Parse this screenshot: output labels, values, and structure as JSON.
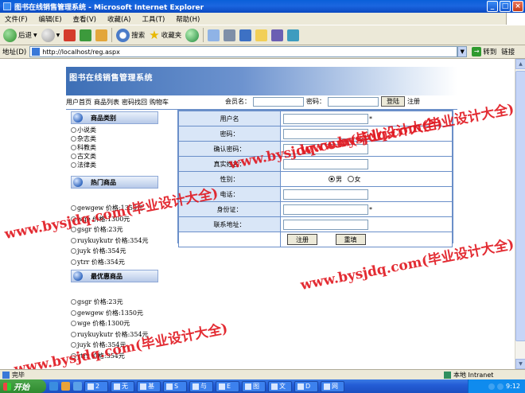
{
  "window": {
    "title": "图书在线销售管理系统 - Microsoft Internet Explorer",
    "minimize": "_",
    "maximize": "□",
    "close": "×"
  },
  "menu": [
    "文件(F)",
    "编辑(E)",
    "查看(V)",
    "收藏(A)",
    "工具(T)",
    "帮助(H)"
  ],
  "toolbar": {
    "back": "后退",
    "search": "搜索",
    "favorites": "收藏夹"
  },
  "address": {
    "label": "地址(D)",
    "url": "http://localhost/reg.aspx",
    "go": "转到",
    "links": "链接"
  },
  "site": {
    "title": "图书在线销售管理系统",
    "nav": [
      "用户首页",
      "商品列表",
      "密码找回",
      "购物车"
    ],
    "login": {
      "member_label": "会员名：",
      "password_label": "密码：",
      "login_button": "登陆",
      "register_link": "注册"
    }
  },
  "sidebar": {
    "categories_title": "商品类别",
    "categories": [
      "小说类",
      "杂志类",
      "科教类",
      "古文类",
      "法律类"
    ],
    "hot_title": "热门商品",
    "hot_items": [
      "gewgew 价格:1350元",
      "wge 价格:1300元",
      "gsgr 价格:23元",
      "ruykuykutr 价格:354元",
      "juyk 价格:354元",
      "ytrr 价格:354元"
    ],
    "cheap_title": "最优惠商品",
    "cheap_items": [
      "gsgr 价格:23元",
      "gewgew 价格:1350元",
      "wge 价格:1300元",
      "ruykuykutr 价格:354元",
      "juyk 价格:354元",
      "ytrr 价格:354元"
    ]
  },
  "form": {
    "username_label": "用户名",
    "password_label": "密码：",
    "confirm_label": "确认密码：",
    "realname_label": "真实姓名：",
    "gender_label": "性别：",
    "gender_male": "男",
    "gender_female": "女",
    "phone_label": "电话：",
    "idcard_label": "身份证：",
    "address_label": "联系地址：",
    "required_mark": "*",
    "register_button": "注册",
    "reset_button": "重填"
  },
  "watermark": [
    "www.bysjdq.com(毕业设计大全)",
    "www.bysjdq.com(毕业设计大全)",
    "www.bysjdq.com(毕业设计大全)",
    "www.bysjdq.com(毕业设计大全)",
    "www.bysjdq.com(毕业设计大全)"
  ],
  "status": {
    "text": "完毕",
    "zone": "本地 Intranet"
  },
  "taskbar": {
    "start": "开始",
    "tasks": [
      "2",
      "无",
      "基",
      "S",
      "与",
      "E",
      "图",
      "文",
      "D",
      "网"
    ],
    "clock": "9:12"
  }
}
